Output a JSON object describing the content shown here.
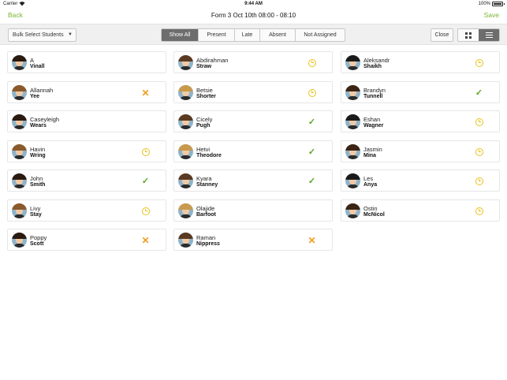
{
  "status_bar": {
    "carrier": "Carrier",
    "time": "9:44 AM",
    "battery": "100%"
  },
  "nav": {
    "back_label": "Back",
    "title": "Form 3 Oct 10th 08:00 - 08:10",
    "save_label": "Save",
    "accent_color": "#79b530"
  },
  "toolbar": {
    "bulk_select_label": "Bulk Select Students",
    "filters": [
      "Show All",
      "Present",
      "Late",
      "Absent",
      "Not Assigned"
    ],
    "active_filter": "Show All",
    "close_label": "Close",
    "view_modes": [
      "grid-view",
      "list-view"
    ],
    "active_view": "list-view"
  },
  "status_colors": {
    "present": "#5aa623",
    "late": "#e8c21a",
    "absent": "#f29c1f"
  },
  "students": [
    {
      "first": "A",
      "last": "Vinall",
      "status": "none"
    },
    {
      "first": "Abdirahman",
      "last": "Straw",
      "status": "late"
    },
    {
      "first": "Aleksandr",
      "last": "Shaikh",
      "status": "late"
    },
    {
      "first": "Allannah",
      "last": "Yee",
      "status": "absent"
    },
    {
      "first": "Betsie",
      "last": "Shorter",
      "status": "late"
    },
    {
      "first": "Brandyn",
      "last": "Tunnell",
      "status": "present"
    },
    {
      "first": "Caseyleigh",
      "last": "Wears",
      "status": "none"
    },
    {
      "first": "Cicely",
      "last": "Pugh",
      "status": "present"
    },
    {
      "first": "Eshan",
      "last": "Wagner",
      "status": "late"
    },
    {
      "first": "Havin",
      "last": "Wring",
      "status": "late"
    },
    {
      "first": "Hetvi",
      "last": "Theodore",
      "status": "present"
    },
    {
      "first": "Jasmin",
      "last": "Mina",
      "status": "late"
    },
    {
      "first": "John",
      "last": "Smith",
      "status": "present"
    },
    {
      "first": "Kyara",
      "last": "Stanney",
      "status": "present"
    },
    {
      "first": "Les",
      "last": "Anya",
      "status": "late"
    },
    {
      "first": "Livy",
      "last": "Stay",
      "status": "late"
    },
    {
      "first": "Olajide",
      "last": "Barfoot",
      "status": "none"
    },
    {
      "first": "Ostin",
      "last": "McNicol",
      "status": "late"
    },
    {
      "first": "Poppy",
      "last": "Scott",
      "status": "absent"
    },
    {
      "first": "Raman",
      "last": "Nippress",
      "status": "absent"
    }
  ]
}
